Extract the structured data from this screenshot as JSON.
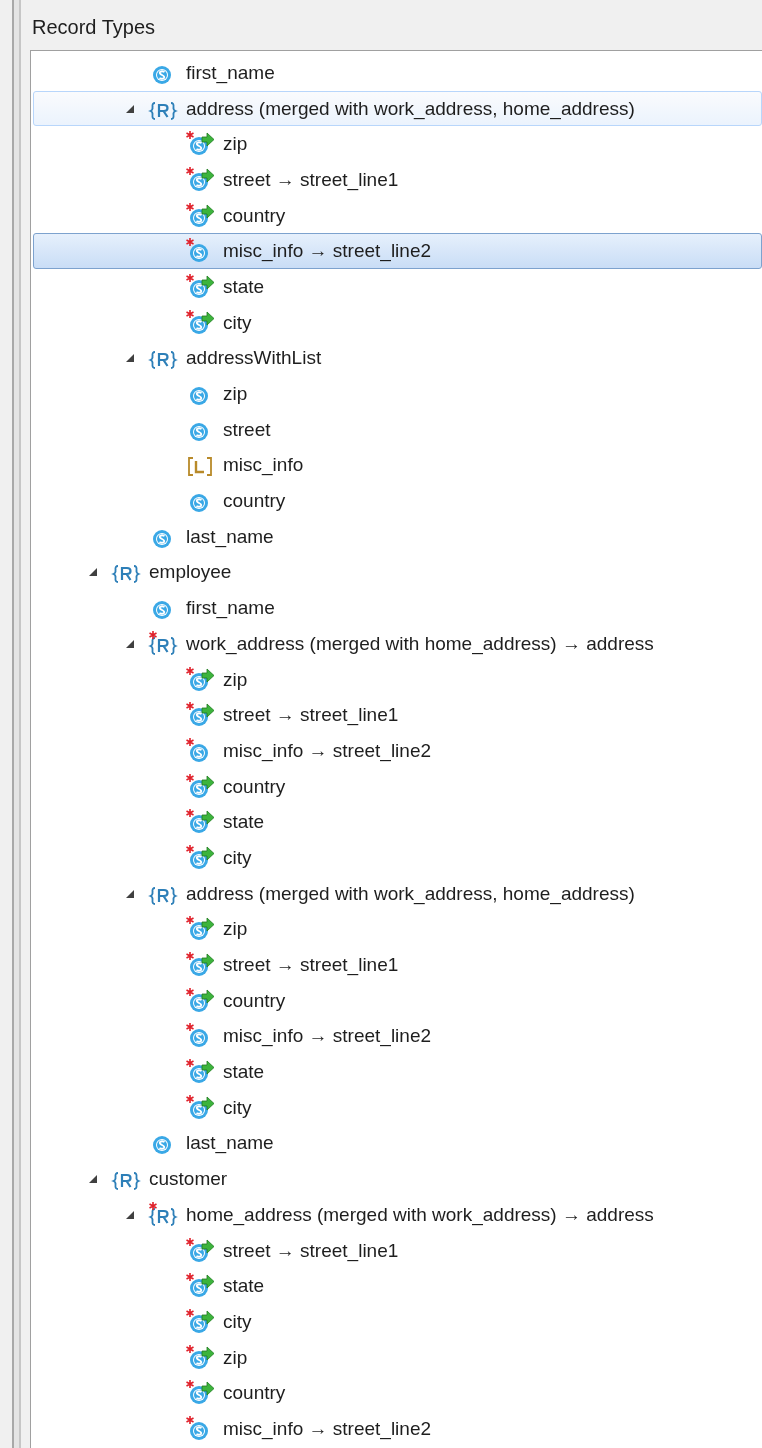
{
  "panel": {
    "title": "Record Types"
  },
  "tree": {
    "partial_items": [
      {
        "label": "first_name",
        "kind": "string",
        "required": false,
        "mapped": false,
        "selected": false,
        "hovered": false
      },
      {
        "label": "address (merged with work_address, home_address)",
        "kind": "record",
        "required": false,
        "mapped": false,
        "selected": false,
        "hovered": true,
        "expanded": true,
        "children": [
          {
            "label": "zip",
            "kind": "string",
            "required": true,
            "mapped": true,
            "selected": false,
            "hovered": false
          },
          {
            "label": "street → street_line1",
            "kind": "string",
            "required": true,
            "mapped": true,
            "selected": false,
            "hovered": false
          },
          {
            "label": "country",
            "kind": "string",
            "required": true,
            "mapped": true,
            "selected": false,
            "hovered": false
          },
          {
            "label": "misc_info → street_line2",
            "kind": "string",
            "required": true,
            "mapped": false,
            "selected": true,
            "hovered": false
          },
          {
            "label": "state",
            "kind": "string",
            "required": true,
            "mapped": true,
            "selected": false,
            "hovered": false
          },
          {
            "label": "city",
            "kind": "string",
            "required": true,
            "mapped": true,
            "selected": false,
            "hovered": false
          }
        ]
      },
      {
        "label": "addressWithList",
        "kind": "record",
        "required": false,
        "mapped": false,
        "selected": false,
        "hovered": false,
        "expanded": true,
        "children": [
          {
            "label": "zip",
            "kind": "string",
            "required": false,
            "mapped": false,
            "selected": false,
            "hovered": false
          },
          {
            "label": "street",
            "kind": "string",
            "required": false,
            "mapped": false,
            "selected": false,
            "hovered": false
          },
          {
            "label": "misc_info",
            "kind": "list",
            "required": false,
            "mapped": false,
            "selected": false,
            "hovered": false
          },
          {
            "label": "country",
            "kind": "string",
            "required": false,
            "mapped": false,
            "selected": false,
            "hovered": false
          }
        ]
      },
      {
        "label": "last_name",
        "kind": "string",
        "required": false,
        "mapped": false,
        "selected": false,
        "hovered": false
      }
    ],
    "items": [
      {
        "label": "employee",
        "kind": "record",
        "required": false,
        "mapped": false,
        "selected": false,
        "hovered": false,
        "expanded": true,
        "children": [
          {
            "label": "first_name",
            "kind": "string",
            "required": false,
            "mapped": false,
            "selected": false,
            "hovered": false
          },
          {
            "label": "work_address (merged with home_address) → address",
            "kind": "record",
            "required": true,
            "mapped": false,
            "selected": false,
            "hovered": false,
            "expanded": true,
            "children": [
              {
                "label": "zip",
                "kind": "string",
                "required": true,
                "mapped": true,
                "selected": false,
                "hovered": false
              },
              {
                "label": "street → street_line1",
                "kind": "string",
                "required": true,
                "mapped": true,
                "selected": false,
                "hovered": false
              },
              {
                "label": "misc_info → street_line2",
                "kind": "string",
                "required": true,
                "mapped": false,
                "selected": false,
                "hovered": false
              },
              {
                "label": "country",
                "kind": "string",
                "required": true,
                "mapped": true,
                "selected": false,
                "hovered": false
              },
              {
                "label": "state",
                "kind": "string",
                "required": true,
                "mapped": true,
                "selected": false,
                "hovered": false
              },
              {
                "label": "city",
                "kind": "string",
                "required": true,
                "mapped": true,
                "selected": false,
                "hovered": false
              }
            ]
          },
          {
            "label": "address (merged with work_address, home_address)",
            "kind": "record",
            "required": false,
            "mapped": false,
            "selected": false,
            "hovered": false,
            "expanded": true,
            "children": [
              {
                "label": "zip",
                "kind": "string",
                "required": true,
                "mapped": true,
                "selected": false,
                "hovered": false
              },
              {
                "label": "street → street_line1",
                "kind": "string",
                "required": true,
                "mapped": true,
                "selected": false,
                "hovered": false
              },
              {
                "label": "country",
                "kind": "string",
                "required": true,
                "mapped": true,
                "selected": false,
                "hovered": false
              },
              {
                "label": "misc_info → street_line2",
                "kind": "string",
                "required": true,
                "mapped": false,
                "selected": false,
                "hovered": false
              },
              {
                "label": "state",
                "kind": "string",
                "required": true,
                "mapped": true,
                "selected": false,
                "hovered": false
              },
              {
                "label": "city",
                "kind": "string",
                "required": true,
                "mapped": true,
                "selected": false,
                "hovered": false
              }
            ]
          },
          {
            "label": "last_name",
            "kind": "string",
            "required": false,
            "mapped": false,
            "selected": false,
            "hovered": false
          }
        ]
      },
      {
        "label": "customer",
        "kind": "record",
        "required": false,
        "mapped": false,
        "selected": false,
        "hovered": false,
        "expanded": true,
        "children": [
          {
            "label": "home_address (merged with work_address) → address",
            "kind": "record",
            "required": true,
            "mapped": false,
            "selected": false,
            "hovered": false,
            "expanded": true,
            "children": [
              {
                "label": "street → street_line1",
                "kind": "string",
                "required": true,
                "mapped": true,
                "selected": false,
                "hovered": false
              },
              {
                "label": "state",
                "kind": "string",
                "required": true,
                "mapped": true,
                "selected": false,
                "hovered": false
              },
              {
                "label": "city",
                "kind": "string",
                "required": true,
                "mapped": true,
                "selected": false,
                "hovered": false
              },
              {
                "label": "zip",
                "kind": "string",
                "required": true,
                "mapped": true,
                "selected": false,
                "hovered": false
              },
              {
                "label": "country",
                "kind": "string",
                "required": true,
                "mapped": true,
                "selected": false,
                "hovered": false
              },
              {
                "label": "misc_info → street_line2",
                "kind": "string",
                "required": true,
                "mapped": false,
                "selected": false,
                "hovered": false
              }
            ]
          }
        ]
      }
    ]
  }
}
